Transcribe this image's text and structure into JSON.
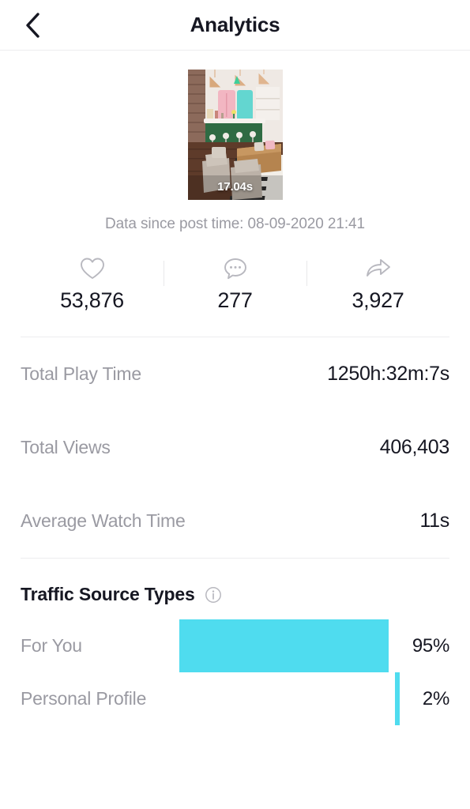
{
  "header": {
    "title": "Analytics",
    "back_icon": "chevron-left-icon"
  },
  "video": {
    "duration_label": "17.04s",
    "data_since": "Data since post time: 08-09-2020 21:41"
  },
  "engagement": [
    {
      "icon": "heart-icon",
      "name": "likes",
      "value": "53,876"
    },
    {
      "icon": "comment-icon",
      "name": "comments",
      "value": "277"
    },
    {
      "icon": "share-icon",
      "name": "shares",
      "value": "3,927"
    }
  ],
  "metrics": [
    {
      "label": "Total Play Time",
      "value": "1250h:32m:7s"
    },
    {
      "label": "Total Views",
      "value": "406,403"
    },
    {
      "label": "Average Watch Time",
      "value": "11s"
    }
  ],
  "traffic": {
    "title": "Traffic Source Types",
    "info_icon": "info-circle-icon",
    "bar_color": "#4fdcef",
    "rows": [
      {
        "label": "For You",
        "percent_label": "95%",
        "percent": 95
      },
      {
        "label": "Personal Profile",
        "percent_label": "2%",
        "percent": 2
      }
    ]
  },
  "chart_data": {
    "type": "bar",
    "title": "Traffic Source Types",
    "orientation": "horizontal",
    "categories": [
      "For You",
      "Personal Profile"
    ],
    "values": [
      95,
      2
    ],
    "unit": "%",
    "xlabel": "",
    "ylabel": "",
    "xlim": [
      0,
      100
    ],
    "grid": false,
    "legend": "none",
    "series_color": "#4fdcef"
  }
}
